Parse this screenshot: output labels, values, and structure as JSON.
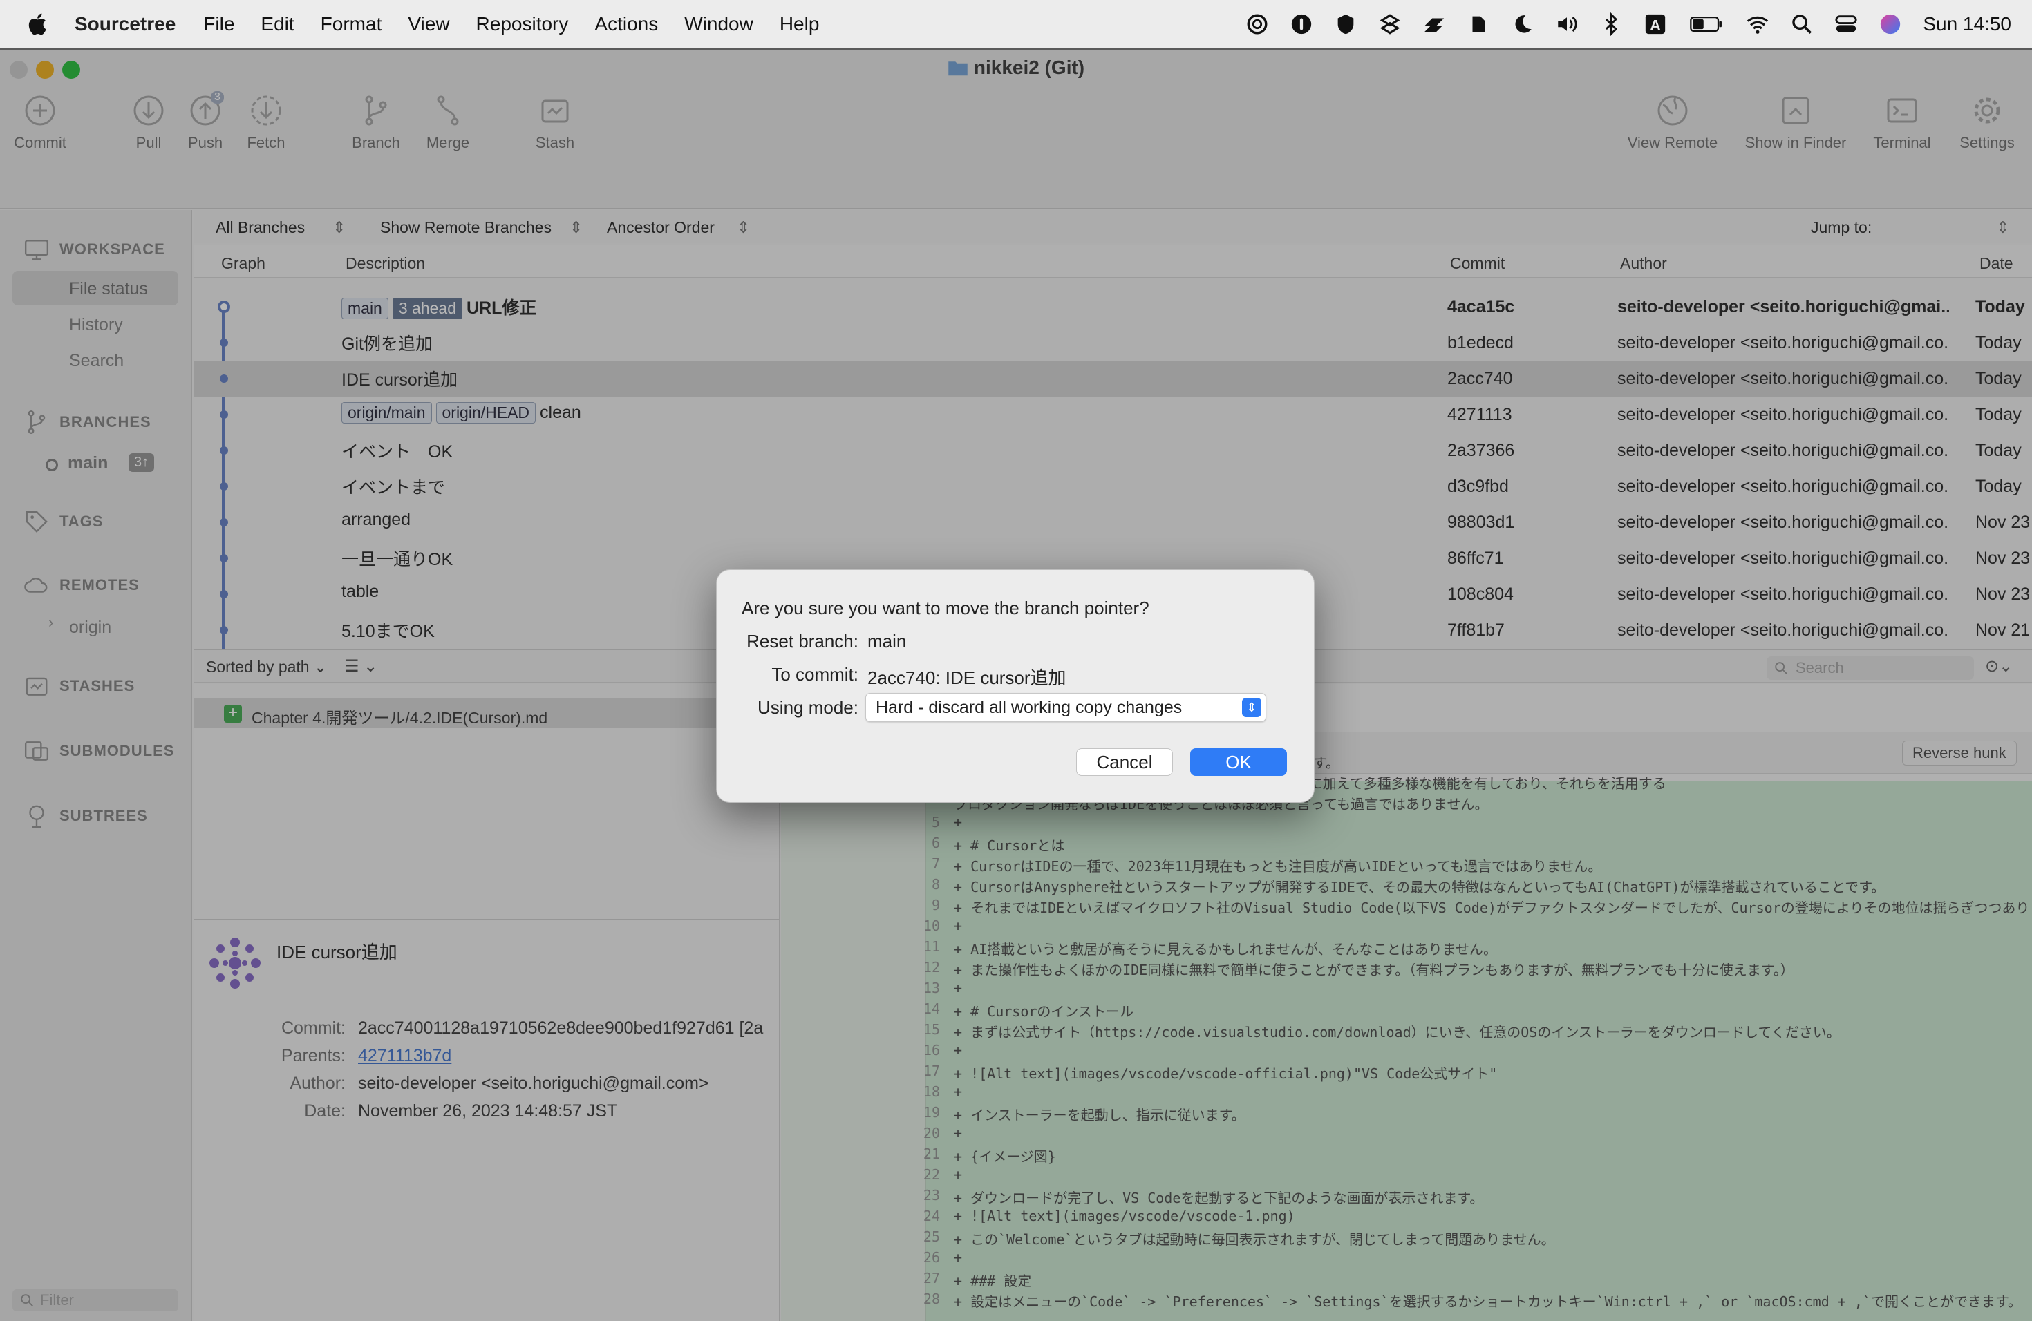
{
  "menubar": {
    "app": "Sourcetree",
    "items": [
      "File",
      "Edit",
      "Format",
      "View",
      "Repository",
      "Actions",
      "Window",
      "Help"
    ],
    "status_icons": [
      "openai-icon",
      "password-icon",
      "shield-icon",
      "vpn-icon",
      "lightning-icon",
      "evernote-icon",
      "moon-icon",
      "volume-icon",
      "bluetooth-icon",
      "input-a-icon",
      "battery-icon",
      "wifi-icon",
      "spotlight-icon",
      "control-center-icon",
      "siri-icon"
    ],
    "input_label": "A",
    "clock": "Sun  14:50"
  },
  "window": {
    "title": "nikkei2 (Git)",
    "toolbar_left": [
      "Commit",
      "Pull",
      "Push",
      "Fetch",
      "Branch",
      "Merge",
      "Stash"
    ],
    "push_badge": "3",
    "toolbar_right": [
      "View Remote",
      "Show in Finder",
      "Terminal",
      "Settings"
    ]
  },
  "sidebar": {
    "workspace": "WORKSPACE",
    "workspace_items": [
      "File status",
      "History",
      "Search"
    ],
    "branches": "BRANCHES",
    "branch_name": "main",
    "branch_badge": "3↑",
    "tags": "TAGS",
    "remotes": "REMOTES",
    "remote_name": "origin",
    "stashes": "STASHES",
    "submodules": "SUBMODULES",
    "subtrees": "SUBTREES",
    "filter_placeholder": "Filter"
  },
  "filters": {
    "branches": "All Branches",
    "remote": "Show Remote Branches",
    "order": "Ancestor Order",
    "jump": "Jump to:"
  },
  "columns": {
    "graph": "Graph",
    "description": "Description",
    "commit": "Commit",
    "author": "Author",
    "date": "Date"
  },
  "commits": [
    {
      "tags": [
        "main"
      ],
      "ahead": "3 ahead",
      "desc": "URL修正",
      "hash": "4aca15c",
      "author": "seito-developer <seito.horiguchi@gmai...",
      "date": "Today",
      "bold": true
    },
    {
      "tags": [],
      "ahead": "",
      "desc": "Git例を追加",
      "hash": "b1edecd",
      "author": "seito-developer <seito.horiguchi@gmail.co...",
      "date": "Today"
    },
    {
      "tags": [],
      "ahead": "",
      "desc": "IDE cursor追加",
      "hash": "2acc740",
      "author": "seito-developer <seito.horiguchi@gmail.co...",
      "date": "Today"
    },
    {
      "tags": [
        "origin/main",
        "origin/HEAD"
      ],
      "ahead": "",
      "desc": "clean",
      "hash": "4271113",
      "author": "seito-developer <seito.horiguchi@gmail.co...",
      "date": "Today"
    },
    {
      "tags": [],
      "ahead": "",
      "desc": "イベント　OK",
      "hash": "2a37366",
      "author": "seito-developer <seito.horiguchi@gmail.co...",
      "date": "Today"
    },
    {
      "tags": [],
      "ahead": "",
      "desc": "イベントまで",
      "hash": "d3c9fbd",
      "author": "seito-developer <seito.horiguchi@gmail.co...",
      "date": "Today"
    },
    {
      "tags": [],
      "ahead": "",
      "desc": "arranged",
      "hash": "98803d1",
      "author": "seito-developer <seito.horiguchi@gmail.co...",
      "date": "Nov 23"
    },
    {
      "tags": [],
      "ahead": "",
      "desc": "一旦一通りOK",
      "hash": "86ffc71",
      "author": "seito-developer <seito.horiguchi@gmail.co...",
      "date": "Nov 23"
    },
    {
      "tags": [],
      "ahead": "",
      "desc": "table",
      "hash": "108c804",
      "author": "seito-developer <seito.horiguchi@gmail.co...",
      "date": "Nov 23"
    },
    {
      "tags": [],
      "ahead": "",
      "desc": "5.10までOK",
      "hash": "7ff81b7",
      "author": "seito-developer <seito.horiguchi@gmail.co...",
      "date": "Nov 21"
    }
  ],
  "files": {
    "sort": "Sorted by path",
    "file": "Chapter 4.開発ツール/4.2.IDE(Cursor).md",
    "search_placeholder": "Search",
    "reverse_hunk": "Reverse hunk"
  },
  "details": {
    "title": "IDE cursor追加",
    "commit_label": "Commit:",
    "commit": "2acc74001128a19710562e8dee900bed1f927d61 [2a",
    "parents_label": "Parents:",
    "parents": "4271113b7d",
    "author_label": "Author:",
    "author": "seito-developer <seito.horiguchi@gmail.com>",
    "date_label": "Date:",
    "date": "November 26, 2023 14:48:57 JST"
  },
  "diff": [
    {
      "n": "",
      "t": "は、開発に必要なツールを一つにまとめたソフトウェアです。"
    },
    {
      "n": "",
      "t": "ェアのことはテキストエディタと呼びますが、IDEはそれに加えて多種多様な機能を有しており、それらを活用する"
    },
    {
      "n": "",
      "t": "プロダクション開発ならばIDEを使うことはほぼ必須と言っても過言ではありません。"
    },
    {
      "n": "5",
      "t": "+"
    },
    {
      "n": "6",
      "t": "+ # Cursorとは"
    },
    {
      "n": "7",
      "t": "+ CursorはIDEの一種で、2023年11月現在もっとも注目度が高いIDEといっても過言ではありません。"
    },
    {
      "n": "8",
      "t": "+ CursorはAnysphere社というスタートアップが開発するIDEで、その最大の特徴はなんといってもAI(ChatGPT)が標準搭載されていることです。"
    },
    {
      "n": "9",
      "t": "+ それまではIDEといえばマイクロソフト社のVisual Studio Code(以下VS Code)がデファクトスタンダードでしたが、Cursorの登場によりその地位は揺らぎつつあり"
    },
    {
      "n": "10",
      "t": "+"
    },
    {
      "n": "11",
      "t": "+ AI搭載というと敷居が高そうに見えるかもしれませんが、そんなことはありません。"
    },
    {
      "n": "12",
      "t": "+ また操作性もよくほかのIDE同様に無料で簡単に使うことができます。（有料プランもありますが、無料プランでも十分に使えます。）"
    },
    {
      "n": "13",
      "t": "+"
    },
    {
      "n": "14",
      "t": "+ # Cursorのインストール"
    },
    {
      "n": "15",
      "t": "+ まずは公式サイト（https://code.visualstudio.com/download）にいき、任意のOSのインストーラーをダウンロードしてください。"
    },
    {
      "n": "16",
      "t": "+"
    },
    {
      "n": "17",
      "t": "+ ![Alt text](images/vscode/vscode-official.png)\"VS Code公式サイト\""
    },
    {
      "n": "18",
      "t": "+"
    },
    {
      "n": "19",
      "t": "+ インストーラーを起動し、指示に従います。"
    },
    {
      "n": "20",
      "t": "+"
    },
    {
      "n": "21",
      "t": "+ {イメージ図}"
    },
    {
      "n": "22",
      "t": "+"
    },
    {
      "n": "23",
      "t": "+ ダウンロードが完了し、VS Codeを起動すると下記のような画面が表示されます。"
    },
    {
      "n": "24",
      "t": "+ ![Alt text](images/vscode/vscode-1.png)"
    },
    {
      "n": "25",
      "t": "+ この`Welcome`というタブは起動時に毎回表示されますが、閉じてしまって問題ありません。"
    },
    {
      "n": "26",
      "t": "+"
    },
    {
      "n": "27",
      "t": "+ ### 設定"
    },
    {
      "n": "28",
      "t": "+ 設定はメニューの`Code` -> `Preferences` -> `Settings`を選択するかショートカットキー`Win:ctrl + ,` or `macOS:cmd + ,`で開くことができます。"
    }
  ],
  "dialog": {
    "question": "Are you sure you want to move the branch pointer?",
    "reset_label": "Reset branch:",
    "reset_value": "main",
    "commit_label": "To commit:",
    "commit_value": "2acc740: IDE cursor追加",
    "mode_label": "Using mode:",
    "mode_value": "Hard - discard all working copy changes",
    "cancel": "Cancel",
    "ok": "OK"
  },
  "colors": {
    "accent": "#2f7cf6",
    "diff_bg": "#cfe9d4",
    "graph": "#6b86c8"
  }
}
